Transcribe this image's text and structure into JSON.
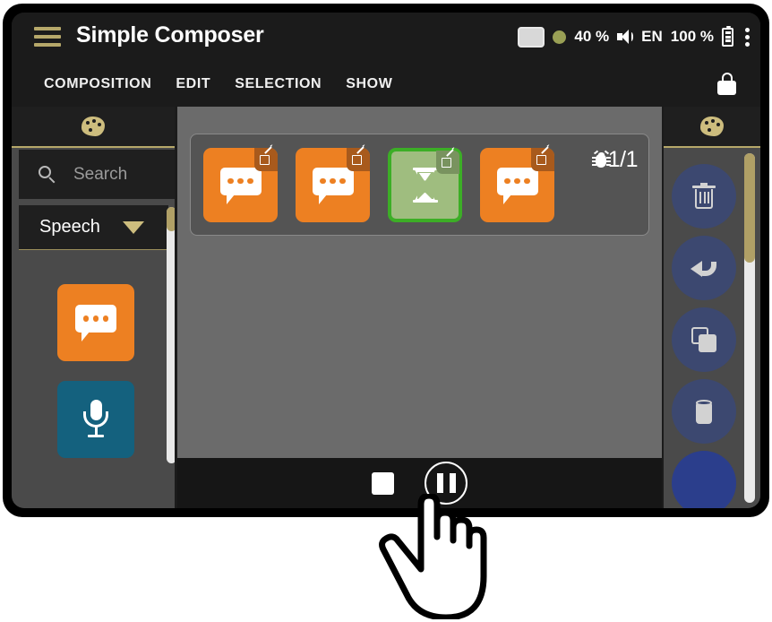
{
  "app": {
    "title": "Simple Composer",
    "menu_icon": "hamburger-icon"
  },
  "statusbar": {
    "screen_icon": "display-icon",
    "record_dot_color": "#9aa055",
    "brightness": "40 %",
    "speaker_icon": "speaker-icon",
    "language": "EN",
    "battery_level": "100 %",
    "battery_icon": "battery-icon",
    "overflow_icon": "kebab-menu-icon"
  },
  "menubar": {
    "items": [
      {
        "label": "COMPOSITION"
      },
      {
        "label": "EDIT"
      },
      {
        "label": "SELECTION"
      },
      {
        "label": "SHOW"
      }
    ],
    "lock_icon": "lock-closed-icon"
  },
  "left_panel": {
    "header_icon": "palette-icon",
    "search": {
      "icon": "search-icon",
      "placeholder": "Search",
      "value": ""
    },
    "category": {
      "label": "Speech",
      "chevron": "chevron-down-icon",
      "expanded": true
    },
    "tiles": [
      {
        "name": "speech-bubble-tile",
        "icon": "speech-bubble-icon",
        "color": "#ed8022"
      },
      {
        "name": "microphone-tile",
        "icon": "microphone-icon",
        "color": "#14617e"
      }
    ]
  },
  "canvas": {
    "blocks": [
      {
        "type": "speech",
        "icon": "speech-bubble-icon",
        "color": "#ed8022",
        "selected": false,
        "badge": "edit-pencil-icon"
      },
      {
        "type": "speech",
        "icon": "speech-bubble-icon",
        "color": "#ed8022",
        "selected": false,
        "badge": "edit-pencil-icon"
      },
      {
        "type": "wait",
        "icon": "hourglass-icon",
        "color": "#9fbd7f",
        "selected": true,
        "badge": "edit-pencil-icon"
      },
      {
        "type": "speech",
        "icon": "speech-bubble-icon",
        "color": "#ed8022",
        "selected": false,
        "badge": "edit-pencil-icon"
      }
    ],
    "debug": {
      "icon": "bug-icon",
      "counter": "1/1"
    },
    "selection_color": "#3cae26"
  },
  "transport": {
    "stop_label": "stop-button",
    "pause_label": "pause-button"
  },
  "right_panel": {
    "header_icon": "palette-icon",
    "actions": [
      {
        "name": "delete-button",
        "icon": "trash-icon"
      },
      {
        "name": "undo-button",
        "icon": "undo-arrow-icon"
      },
      {
        "name": "duplicate-button",
        "icon": "copy-icon"
      },
      {
        "name": "paste-button",
        "icon": "paste-icon"
      },
      {
        "name": "more-button",
        "icon": "more-icon"
      }
    ]
  },
  "cursor": {
    "type": "pointing-hand-cursor"
  }
}
